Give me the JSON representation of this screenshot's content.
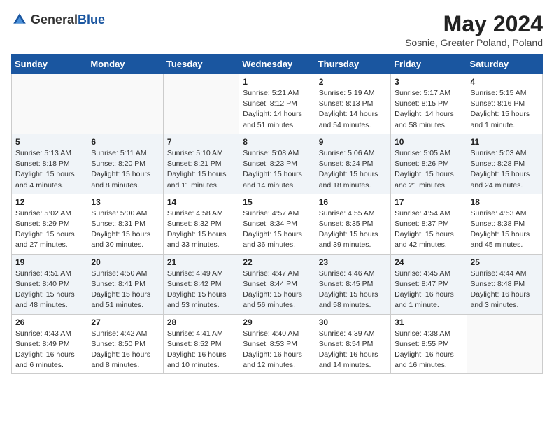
{
  "header": {
    "logo_general": "General",
    "logo_blue": "Blue",
    "title": "May 2024",
    "subtitle": "Sosnie, Greater Poland, Poland"
  },
  "days_of_week": [
    "Sunday",
    "Monday",
    "Tuesday",
    "Wednesday",
    "Thursday",
    "Friday",
    "Saturday"
  ],
  "weeks": [
    [
      {
        "day": "",
        "sunrise": "",
        "sunset": "",
        "daylight": "",
        "empty": true
      },
      {
        "day": "",
        "sunrise": "",
        "sunset": "",
        "daylight": "",
        "empty": true
      },
      {
        "day": "",
        "sunrise": "",
        "sunset": "",
        "daylight": "",
        "empty": true
      },
      {
        "day": "1",
        "sunrise": "Sunrise: 5:21 AM",
        "sunset": "Sunset: 8:12 PM",
        "daylight": "Daylight: 14 hours and 51 minutes.",
        "empty": false
      },
      {
        "day": "2",
        "sunrise": "Sunrise: 5:19 AM",
        "sunset": "Sunset: 8:13 PM",
        "daylight": "Daylight: 14 hours and 54 minutes.",
        "empty": false
      },
      {
        "day": "3",
        "sunrise": "Sunrise: 5:17 AM",
        "sunset": "Sunset: 8:15 PM",
        "daylight": "Daylight: 14 hours and 58 minutes.",
        "empty": false
      },
      {
        "day": "4",
        "sunrise": "Sunrise: 5:15 AM",
        "sunset": "Sunset: 8:16 PM",
        "daylight": "Daylight: 15 hours and 1 minute.",
        "empty": false
      }
    ],
    [
      {
        "day": "5",
        "sunrise": "Sunrise: 5:13 AM",
        "sunset": "Sunset: 8:18 PM",
        "daylight": "Daylight: 15 hours and 4 minutes.",
        "empty": false
      },
      {
        "day": "6",
        "sunrise": "Sunrise: 5:11 AM",
        "sunset": "Sunset: 8:20 PM",
        "daylight": "Daylight: 15 hours and 8 minutes.",
        "empty": false
      },
      {
        "day": "7",
        "sunrise": "Sunrise: 5:10 AM",
        "sunset": "Sunset: 8:21 PM",
        "daylight": "Daylight: 15 hours and 11 minutes.",
        "empty": false
      },
      {
        "day": "8",
        "sunrise": "Sunrise: 5:08 AM",
        "sunset": "Sunset: 8:23 PM",
        "daylight": "Daylight: 15 hours and 14 minutes.",
        "empty": false
      },
      {
        "day": "9",
        "sunrise": "Sunrise: 5:06 AM",
        "sunset": "Sunset: 8:24 PM",
        "daylight": "Daylight: 15 hours and 18 minutes.",
        "empty": false
      },
      {
        "day": "10",
        "sunrise": "Sunrise: 5:05 AM",
        "sunset": "Sunset: 8:26 PM",
        "daylight": "Daylight: 15 hours and 21 minutes.",
        "empty": false
      },
      {
        "day": "11",
        "sunrise": "Sunrise: 5:03 AM",
        "sunset": "Sunset: 8:28 PM",
        "daylight": "Daylight: 15 hours and 24 minutes.",
        "empty": false
      }
    ],
    [
      {
        "day": "12",
        "sunrise": "Sunrise: 5:02 AM",
        "sunset": "Sunset: 8:29 PM",
        "daylight": "Daylight: 15 hours and 27 minutes.",
        "empty": false
      },
      {
        "day": "13",
        "sunrise": "Sunrise: 5:00 AM",
        "sunset": "Sunset: 8:31 PM",
        "daylight": "Daylight: 15 hours and 30 minutes.",
        "empty": false
      },
      {
        "day": "14",
        "sunrise": "Sunrise: 4:58 AM",
        "sunset": "Sunset: 8:32 PM",
        "daylight": "Daylight: 15 hours and 33 minutes.",
        "empty": false
      },
      {
        "day": "15",
        "sunrise": "Sunrise: 4:57 AM",
        "sunset": "Sunset: 8:34 PM",
        "daylight": "Daylight: 15 hours and 36 minutes.",
        "empty": false
      },
      {
        "day": "16",
        "sunrise": "Sunrise: 4:55 AM",
        "sunset": "Sunset: 8:35 PM",
        "daylight": "Daylight: 15 hours and 39 minutes.",
        "empty": false
      },
      {
        "day": "17",
        "sunrise": "Sunrise: 4:54 AM",
        "sunset": "Sunset: 8:37 PM",
        "daylight": "Daylight: 15 hours and 42 minutes.",
        "empty": false
      },
      {
        "day": "18",
        "sunrise": "Sunrise: 4:53 AM",
        "sunset": "Sunset: 8:38 PM",
        "daylight": "Daylight: 15 hours and 45 minutes.",
        "empty": false
      }
    ],
    [
      {
        "day": "19",
        "sunrise": "Sunrise: 4:51 AM",
        "sunset": "Sunset: 8:40 PM",
        "daylight": "Daylight: 15 hours and 48 minutes.",
        "empty": false
      },
      {
        "day": "20",
        "sunrise": "Sunrise: 4:50 AM",
        "sunset": "Sunset: 8:41 PM",
        "daylight": "Daylight: 15 hours and 51 minutes.",
        "empty": false
      },
      {
        "day": "21",
        "sunrise": "Sunrise: 4:49 AM",
        "sunset": "Sunset: 8:42 PM",
        "daylight": "Daylight: 15 hours and 53 minutes.",
        "empty": false
      },
      {
        "day": "22",
        "sunrise": "Sunrise: 4:47 AM",
        "sunset": "Sunset: 8:44 PM",
        "daylight": "Daylight: 15 hours and 56 minutes.",
        "empty": false
      },
      {
        "day": "23",
        "sunrise": "Sunrise: 4:46 AM",
        "sunset": "Sunset: 8:45 PM",
        "daylight": "Daylight: 15 hours and 58 minutes.",
        "empty": false
      },
      {
        "day": "24",
        "sunrise": "Sunrise: 4:45 AM",
        "sunset": "Sunset: 8:47 PM",
        "daylight": "Daylight: 16 hours and 1 minute.",
        "empty": false
      },
      {
        "day": "25",
        "sunrise": "Sunrise: 4:44 AM",
        "sunset": "Sunset: 8:48 PM",
        "daylight": "Daylight: 16 hours and 3 minutes.",
        "empty": false
      }
    ],
    [
      {
        "day": "26",
        "sunrise": "Sunrise: 4:43 AM",
        "sunset": "Sunset: 8:49 PM",
        "daylight": "Daylight: 16 hours and 6 minutes.",
        "empty": false
      },
      {
        "day": "27",
        "sunrise": "Sunrise: 4:42 AM",
        "sunset": "Sunset: 8:50 PM",
        "daylight": "Daylight: 16 hours and 8 minutes.",
        "empty": false
      },
      {
        "day": "28",
        "sunrise": "Sunrise: 4:41 AM",
        "sunset": "Sunset: 8:52 PM",
        "daylight": "Daylight: 16 hours and 10 minutes.",
        "empty": false
      },
      {
        "day": "29",
        "sunrise": "Sunrise: 4:40 AM",
        "sunset": "Sunset: 8:53 PM",
        "daylight": "Daylight: 16 hours and 12 minutes.",
        "empty": false
      },
      {
        "day": "30",
        "sunrise": "Sunrise: 4:39 AM",
        "sunset": "Sunset: 8:54 PM",
        "daylight": "Daylight: 16 hours and 14 minutes.",
        "empty": false
      },
      {
        "day": "31",
        "sunrise": "Sunrise: 4:38 AM",
        "sunset": "Sunset: 8:55 PM",
        "daylight": "Daylight: 16 hours and 16 minutes.",
        "empty": false
      },
      {
        "day": "",
        "sunrise": "",
        "sunset": "",
        "daylight": "",
        "empty": true
      }
    ]
  ]
}
